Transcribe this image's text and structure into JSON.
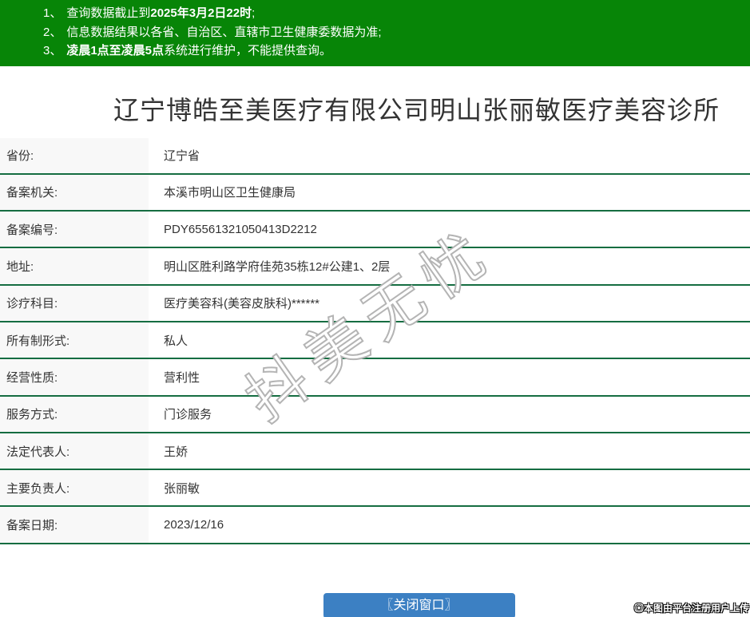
{
  "notice_bar": {
    "bg_color": "#078507",
    "lines": [
      {
        "num": "1、",
        "parts": [
          {
            "t": "查询数据截止到"
          },
          {
            "t": "2025年3月2日22时",
            "b": true
          },
          {
            "t": ";"
          }
        ]
      },
      {
        "num": "2、",
        "parts": [
          {
            "t": "信息数据结果以各省、自治区、直辖市卫生健康委数据为准;"
          }
        ]
      },
      {
        "num": "3、",
        "parts": [
          {
            "t": "凌晨1点至凌晨5点",
            "b": true
          },
          {
            "t": "系统进行维护，不能提供查询。"
          }
        ]
      }
    ]
  },
  "page_title": "辽宁博皓至美医疗有限公司明山张丽敏医疗美容诊所",
  "info_table": {
    "rows": [
      {
        "label": "省份:",
        "value": "辽宁省"
      },
      {
        "label": "备案机关:",
        "value": "本溪市明山区卫生健康局"
      },
      {
        "label": "备案编号:",
        "value": "PDY65561321050413D2212"
      },
      {
        "label": "地址:",
        "value": "明山区胜利路学府佳苑35栋12#公建1、2层"
      },
      {
        "label": "诊疗科目:",
        "value": "医疗美容科(美容皮肤科)******"
      },
      {
        "label": "所有制形式:",
        "value": "私人"
      },
      {
        "label": "经营性质:",
        "value": "营利性"
      },
      {
        "label": "服务方式:",
        "value": "门诊服务"
      },
      {
        "label": "法定代表人:",
        "value": "王娇"
      },
      {
        "label": "主要负责人:",
        "value": "张丽敏"
      },
      {
        "label": "备案日期:",
        "value": "2023/12/16"
      }
    ]
  },
  "watermark": {
    "text": "抖美无忧"
  },
  "footer": {
    "close_button_label": "〖关闭窗口〗",
    "credit": "◎本图由平台注册用户上传"
  },
  "colors": {
    "header_green": "#078507",
    "table_border_green": "#156d41",
    "label_cell_bg": "#f8f8f8",
    "button_blue": "#3c80c3",
    "text_dark": "#333333",
    "watermark_outline": "#b4b4b4"
  }
}
